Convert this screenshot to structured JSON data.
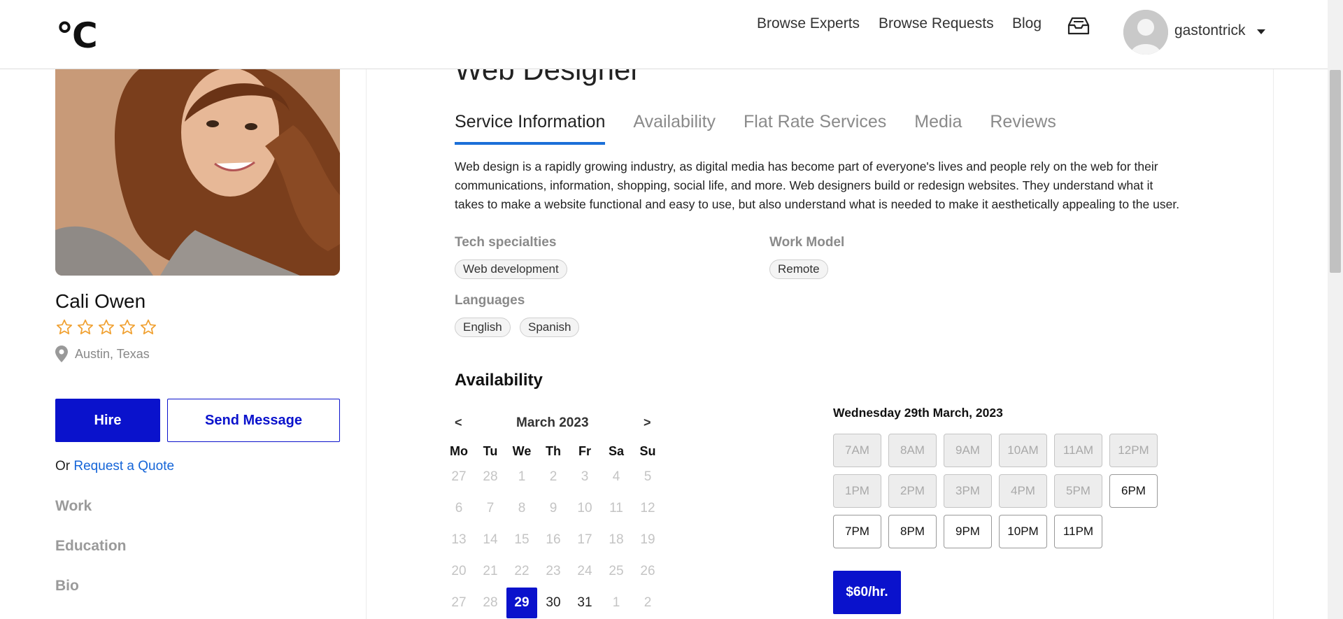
{
  "header": {
    "logo": "°C",
    "nav": [
      "Browse Experts",
      "Browse Requests",
      "Blog"
    ],
    "username": "gastontrick"
  },
  "profile": {
    "name": "Cali Owen",
    "rating": 0,
    "rating_max": 5,
    "location": "Austin, Texas",
    "hire_label": "Hire",
    "message_label": "Send Message",
    "quote_prefix": "Or",
    "quote_link": "Request a Quote",
    "side_links": [
      "Work",
      "Education",
      "Bio"
    ]
  },
  "service": {
    "title": "Web Designer",
    "tabs": [
      "Service Information",
      "Availability",
      "Flat Rate Services",
      "Media",
      "Reviews"
    ],
    "active_tab": 0,
    "description": "Web design is a rapidly growing industry, as digital media has become part of everyone's lives and people rely on the web for their communications, information, shopping, social life, and more. Web designers build or redesign websites. They understand what it takes to make a website functional and easy to use, but also understand what is needed to make it aesthetically appealing to the user.",
    "tech_label": "Tech specialties",
    "tech": [
      "Web development"
    ],
    "work_model_label": "Work Model",
    "work_model": [
      "Remote"
    ],
    "languages_label": "Languages",
    "languages": [
      "English",
      "Spanish"
    ]
  },
  "availability": {
    "title": "Availability",
    "prev": "<",
    "next": ">",
    "month": "March 2023",
    "weekdays": [
      "Mo",
      "Tu",
      "We",
      "Th",
      "Fr",
      "Sa",
      "Su"
    ],
    "weeks": [
      [
        "27",
        "28",
        "1",
        "2",
        "3",
        "4",
        "5"
      ],
      [
        "6",
        "7",
        "8",
        "9",
        "10",
        "11",
        "12"
      ],
      [
        "13",
        "14",
        "15",
        "16",
        "17",
        "18",
        "19"
      ],
      [
        "20",
        "21",
        "22",
        "23",
        "24",
        "25",
        "26"
      ],
      [
        "27",
        "28",
        "29",
        "30",
        "31",
        "1",
        "2"
      ]
    ],
    "selected_day": "29",
    "active_days": [
      "30",
      "31"
    ],
    "date_heading": "Wednesday 29th March, 2023",
    "slots": [
      {
        "label": "7AM",
        "available": false
      },
      {
        "label": "8AM",
        "available": false
      },
      {
        "label": "9AM",
        "available": false
      },
      {
        "label": "10AM",
        "available": false
      },
      {
        "label": "11AM",
        "available": false
      },
      {
        "label": "12PM",
        "available": false
      },
      {
        "label": "1PM",
        "available": false
      },
      {
        "label": "2PM",
        "available": false
      },
      {
        "label": "3PM",
        "available": false
      },
      {
        "label": "4PM",
        "available": false
      },
      {
        "label": "5PM",
        "available": false
      },
      {
        "label": "6PM",
        "available": true
      },
      {
        "label": "7PM",
        "available": true
      },
      {
        "label": "8PM",
        "available": true
      },
      {
        "label": "9PM",
        "available": true
      },
      {
        "label": "10PM",
        "available": true
      },
      {
        "label": "11PM",
        "available": true
      }
    ],
    "rate": "$60/hr."
  },
  "colors": {
    "primary": "#0a12cc",
    "tab_underline": "#1b6fd8",
    "link": "#1565d8",
    "star": "#f0a030"
  }
}
